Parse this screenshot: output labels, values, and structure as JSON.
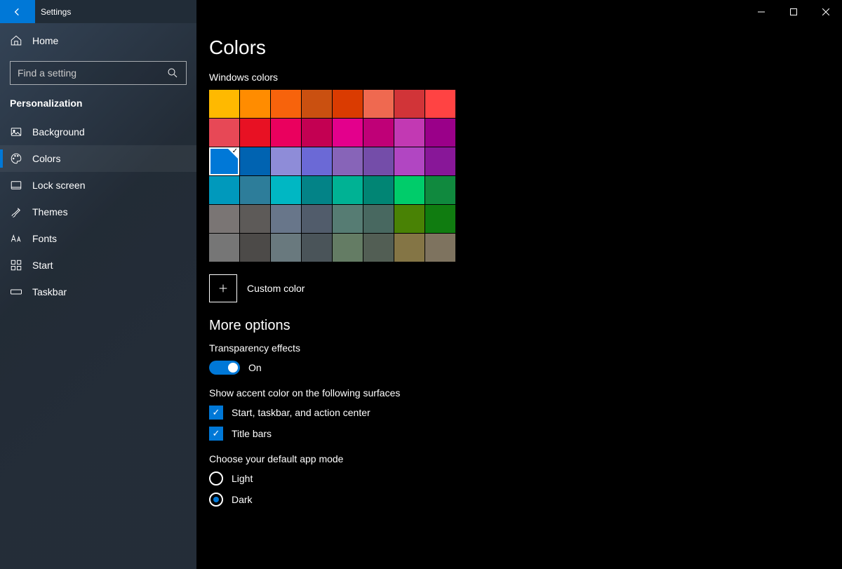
{
  "titlebar": {
    "title": "Settings"
  },
  "accent_color": "#0078D7",
  "sidebar": {
    "home": "Home",
    "search_placeholder": "Find a setting",
    "section": "Personalization",
    "items": [
      {
        "icon": "image",
        "label": "Background",
        "active": false,
        "name": "sidebar-item-background"
      },
      {
        "icon": "palette",
        "label": "Colors",
        "active": true,
        "name": "sidebar-item-colors"
      },
      {
        "icon": "lock",
        "label": "Lock screen",
        "active": false,
        "name": "sidebar-item-lock-screen"
      },
      {
        "icon": "brush",
        "label": "Themes",
        "active": false,
        "name": "sidebar-item-themes"
      },
      {
        "icon": "font",
        "label": "Fonts",
        "active": false,
        "name": "sidebar-item-fonts"
      },
      {
        "icon": "grid",
        "label": "Start",
        "active": false,
        "name": "sidebar-item-start"
      },
      {
        "icon": "taskbar",
        "label": "Taskbar",
        "active": false,
        "name": "sidebar-item-taskbar"
      }
    ]
  },
  "page": {
    "title": "Colors",
    "swatches_label": "Windows colors",
    "custom_label": "Custom color",
    "more_options": "More options",
    "transparency_label": "Transparency effects",
    "transparency_state": "On",
    "accent_surfaces_label": "Show accent color on the following surfaces",
    "check_start": "Start, taskbar, and action center",
    "check_title": "Title bars",
    "app_mode_label": "Choose your default app mode",
    "mode_light": "Light",
    "mode_dark": "Dark"
  },
  "colors_grid": {
    "selected_index": 16,
    "colors": [
      "#FFB900",
      "#FF8C00",
      "#F7630C",
      "#CA5010",
      "#DA3B01",
      "#EF6950",
      "#D13438",
      "#FF4343",
      "#E74856",
      "#E81123",
      "#EA005E",
      "#C30052",
      "#E3008C",
      "#BF0077",
      "#C239B3",
      "#9A0089",
      "#0078D7",
      "#0063B1",
      "#8E8CD8",
      "#6B69D6",
      "#8764B8",
      "#744DA9",
      "#B146C2",
      "#881798",
      "#0099BC",
      "#2D7D9A",
      "#00B7C3",
      "#038387",
      "#00B294",
      "#018574",
      "#00CC6A",
      "#10893E",
      "#7A7574",
      "#5D5A58",
      "#68768A",
      "#515C6B",
      "#567C73",
      "#486860",
      "#498205",
      "#107C10",
      "#767676",
      "#4C4A48",
      "#69797E",
      "#4A5459",
      "#647C64",
      "#525E54",
      "#847545",
      "#7E735F"
    ]
  }
}
